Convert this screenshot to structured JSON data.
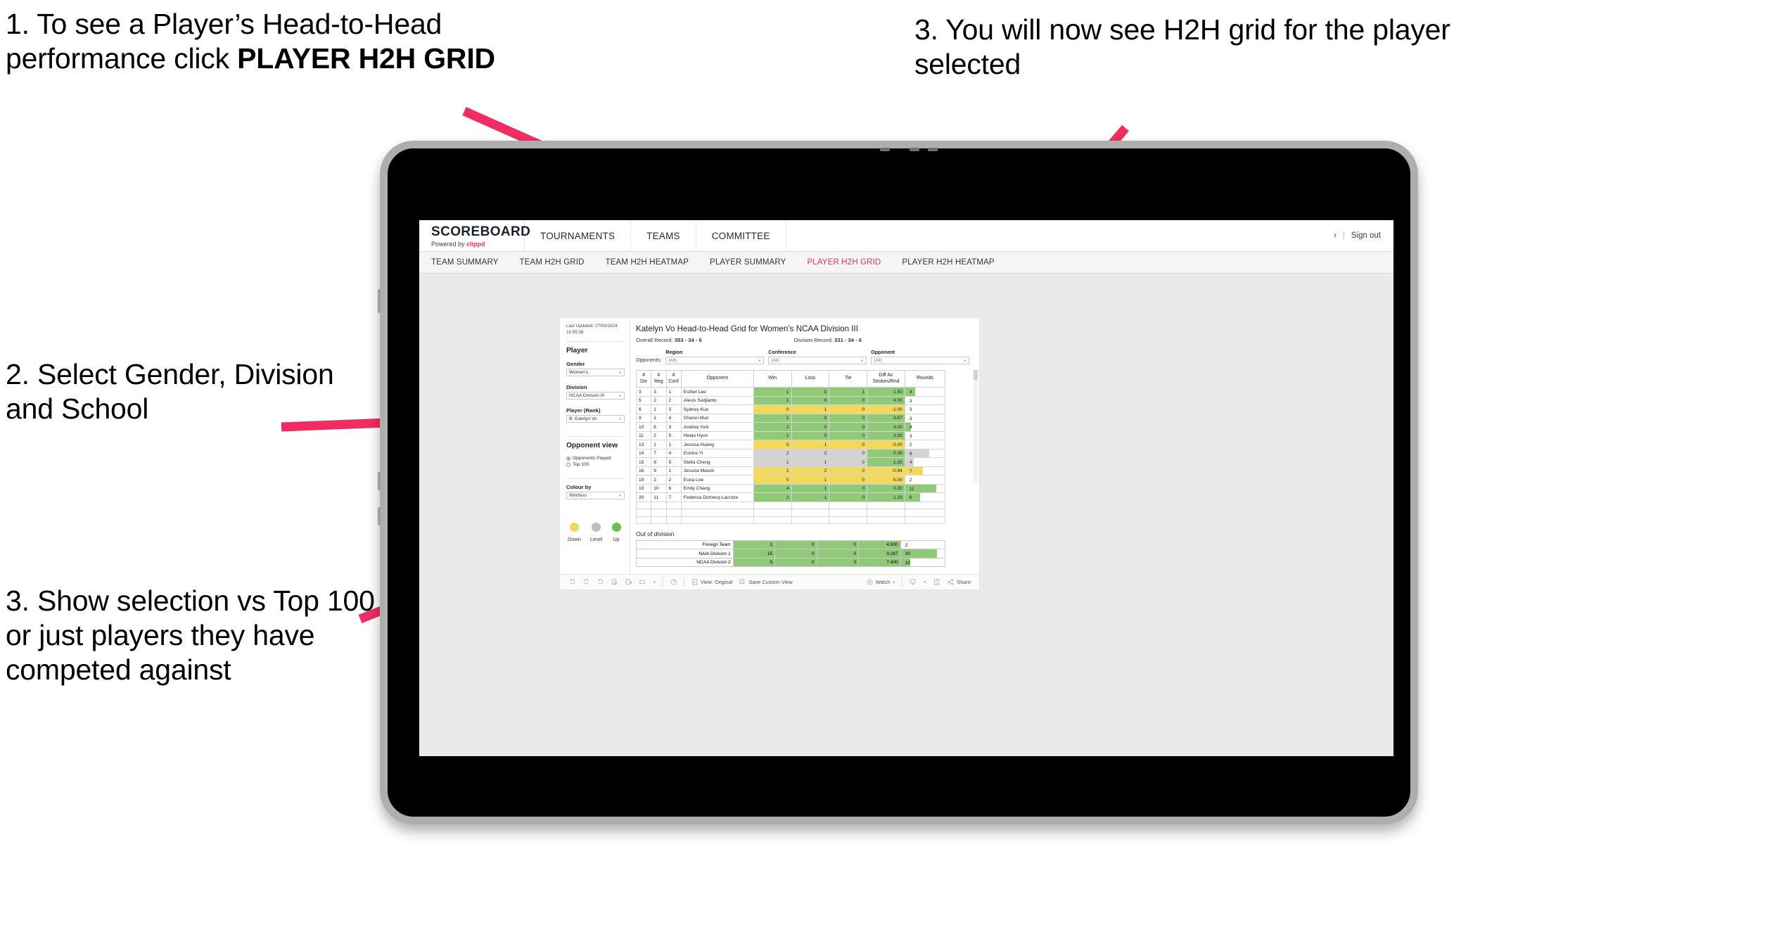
{
  "annotations": [
    {
      "id": "anno-1",
      "text_plain": "1. To see a Player’s Head-to-Head performance click ",
      "text_bold": "PLAYER H2H GRID"
    },
    {
      "id": "anno-2",
      "text": "2. Select Gender, Division and School"
    },
    {
      "id": "anno-3",
      "text": "3. Show selection vs Top 100 or just players they have competed against"
    },
    {
      "id": "anno-4",
      "text": "3. You will now see H2H grid for the player selected"
    }
  ],
  "colors": {
    "accent": "#e8325e",
    "arrow": "#ef2d62",
    "win_green": "#90c978",
    "loss_yellow": "#f2d95c",
    "level_grey": "#d3d3d3",
    "legend_down": "#f2d95c",
    "legend_level": "#bdbdbd",
    "legend_up": "#6cbf47"
  },
  "app": {
    "brand": {
      "word": "SCOREBOARD",
      "powered_prefix": "Powered by ",
      "powered_name": "clippd"
    },
    "topnav": [
      {
        "label": "TOURNAMENTS"
      },
      {
        "label": "TEAMS"
      },
      {
        "label": "COMMITTEE"
      }
    ],
    "topbar_right": {
      "chevron": "›",
      "separator": "|",
      "signout": "Sign out"
    },
    "subnav": [
      {
        "label": "TEAM SUMMARY",
        "active": false
      },
      {
        "label": "TEAM H2H GRID",
        "active": false
      },
      {
        "label": "TEAM H2H HEATMAP",
        "active": false
      },
      {
        "label": "PLAYER SUMMARY",
        "active": false
      },
      {
        "label": "PLAYER H2H GRID",
        "active": true
      },
      {
        "label": "PLAYER H2H HEATMAP",
        "active": false
      }
    ]
  },
  "sidebar": {
    "last_updated_line1": "Last Updated: 27/03/2024",
    "last_updated_line2": "16:55:38",
    "player_section_title": "Player",
    "fields": [
      {
        "label": "Gender",
        "value": "Women's"
      },
      {
        "label": "Division",
        "value": "NCAA Division III"
      },
      {
        "label": "Player (Rank)",
        "value": "B. Katelyn Vo"
      }
    ],
    "opponent_view_title": "Opponent view",
    "opponent_view_options": [
      {
        "label": "Opponents Played",
        "selected": true
      },
      {
        "label": "Top 100",
        "selected": false
      }
    ],
    "colour_by_label": "Colour by",
    "colour_by_value": "Win/loss",
    "legend": [
      {
        "label": "Down",
        "color": "#f2d95c"
      },
      {
        "label": "Level",
        "color": "#bdbdbd"
      },
      {
        "label": "Up",
        "color": "#6cbf47"
      }
    ]
  },
  "main": {
    "title": "Katelyn Vo Head-to-Head Grid for Women’s NCAA Division III",
    "overall_record_label": "Overall Record: ",
    "overall_record_value": "353 - 34 - 6",
    "division_record_label": "Division Record: ",
    "division_record_value": "331 - 34 - 6",
    "opponents_label": "Opponents:",
    "filters": [
      {
        "label": "Region",
        "value": "(All)"
      },
      {
        "label": "Conference",
        "value": "(All)"
      },
      {
        "label": "Opponent",
        "value": "(All)"
      }
    ],
    "out_of_division_title": "Out of division"
  },
  "chart_data": {
    "type": "table",
    "title": "Katelyn Vo Head-to-Head Grid for Women’s NCAA Division III",
    "columns": [
      "# Div",
      "# Reg",
      "# Conf",
      "Opponent",
      "Win",
      "Loss",
      "Tie",
      "Diff Av Strokes/Rnd",
      "Rounds"
    ],
    "column_headers_multiline": [
      [
        "#",
        "Div"
      ],
      [
        "#",
        "Reg"
      ],
      [
        "#",
        "Conf"
      ],
      [
        "Opponent"
      ],
      [
        "Win"
      ],
      [
        "Loss"
      ],
      [
        "Tie"
      ],
      [
        "Diff Av",
        "Strokes/Rnd"
      ],
      [
        "Rounds"
      ]
    ],
    "rows": [
      {
        "div": "3",
        "reg": "3",
        "conf": "1",
        "opponent": "Esther Lee",
        "win": "1",
        "loss": "0",
        "tie": "1",
        "diff": "1.50",
        "rounds": "4",
        "state": "up",
        "bar": 26
      },
      {
        "div": "5",
        "reg": "2",
        "conf": "2",
        "opponent": "Alexis Sudjianto",
        "win": "1",
        "loss": "0",
        "tie": "0",
        "diff": "4.00",
        "rounds": "3",
        "state": "up",
        "bar": 0
      },
      {
        "div": "6",
        "reg": "1",
        "conf": "3",
        "opponent": "Sydney Kuo",
        "win": "0",
        "loss": "1",
        "tie": "0",
        "diff": "-1.00",
        "rounds": "3",
        "state": "down",
        "bar": 0
      },
      {
        "div": "9",
        "reg": "1",
        "conf": "4",
        "opponent": "Sharon Mun",
        "win": "1",
        "loss": "0",
        "tie": "0",
        "diff": "3.67",
        "rounds": "3",
        "state": "up",
        "bar": 0
      },
      {
        "div": "10",
        "reg": "6",
        "conf": "3",
        "opponent": "Andrea York",
        "win": "2",
        "loss": "0",
        "tie": "0",
        "diff": "4.00",
        "rounds": "4",
        "state": "up",
        "bar": 14
      },
      {
        "div": "11",
        "reg": "2",
        "conf": "5",
        "opponent": "Heejo Hyun",
        "win": "1",
        "loss": "0",
        "tie": "0",
        "diff": "3.33",
        "rounds": "3",
        "state": "up",
        "bar": 0
      },
      {
        "div": "13",
        "reg": "1",
        "conf": "1",
        "opponent": "Jessica Huang",
        "win": "0",
        "loss": "1",
        "tie": "0",
        "diff": "-3.00",
        "rounds": "2",
        "state": "down",
        "bar": 0
      },
      {
        "div": "14",
        "reg": "7",
        "conf": "4",
        "opponent": "Eunice Yi",
        "win": "2",
        "loss": "2",
        "tie": "0",
        "diff": "0.38",
        "rounds": "9",
        "state": "level",
        "bar": 60,
        "diff_state": "up"
      },
      {
        "div": "15",
        "reg": "8",
        "conf": "5",
        "opponent": "Stella Cheng",
        "win": "1",
        "loss": "1",
        "tie": "0",
        "diff": "1.25",
        "rounds": "4",
        "state": "level",
        "bar": 21,
        "diff_state": "up"
      },
      {
        "div": "16",
        "reg": "9",
        "conf": "1",
        "opponent": "Jessica Mason",
        "win": "1",
        "loss": "2",
        "tie": "0",
        "diff": "-0.94",
        "rounds": "7",
        "state": "down",
        "bar": 45
      },
      {
        "div": "18",
        "reg": "2",
        "conf": "2",
        "opponent": "Euna Lee",
        "win": "0",
        "loss": "1",
        "tie": "0",
        "diff": "-5.00",
        "rounds": "2",
        "state": "down",
        "bar": 0
      },
      {
        "div": "19",
        "reg": "10",
        "conf": "6",
        "opponent": "Emily Chang",
        "win": "4",
        "loss": "1",
        "tie": "0",
        "diff": "0.30",
        "rounds": "11",
        "state": "up",
        "bar": 79
      },
      {
        "div": "20",
        "reg": "11",
        "conf": "7",
        "opponent": "Federica Domecq Lacroze",
        "win": "2",
        "loss": "1",
        "tie": "0",
        "diff": "1.33",
        "rounds": "6",
        "state": "up",
        "bar": 37
      }
    ],
    "out_of_division": [
      {
        "name": "Foreign Team",
        "win": "1",
        "loss": "0",
        "tie": "0",
        "diff": "4.500",
        "rounds": "2",
        "state": "up",
        "bar": 0
      },
      {
        "name": "NAIA Division 1",
        "win": "15",
        "loss": "0",
        "tie": "0",
        "diff": "9.267",
        "rounds": "30",
        "state": "up",
        "bar": 83
      },
      {
        "name": "NCAA Division 2",
        "win": "5",
        "loss": "0",
        "tie": "0",
        "diff": "7.400",
        "rounds": "10",
        "state": "up",
        "bar": 22
      }
    ]
  },
  "viz_toolbar": {
    "icons": [
      "undo-icon",
      "redo-icon",
      "revert-icon",
      "refresh-data-icon",
      "pause-icon",
      "rectangle-select-icon",
      "dropdown-caret-icon",
      "highlight-icon"
    ],
    "view_label": "View: Original",
    "save_custom_view_label": "Save Custom View",
    "watch_label": "Watch",
    "download_label": "download-icon",
    "fullscreen_label": "fullscreen-icon",
    "share_label": "Share"
  }
}
